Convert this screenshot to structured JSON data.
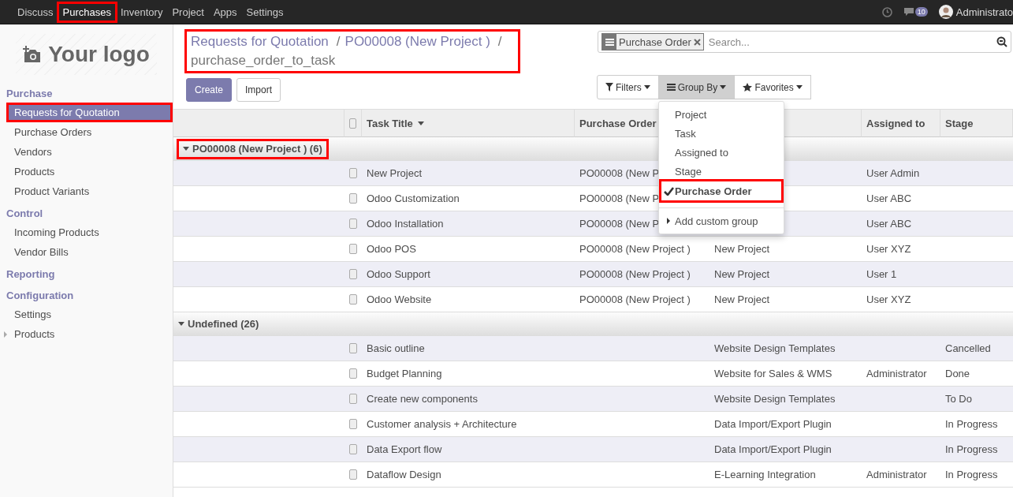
{
  "top_menu": [
    {
      "label": "Discuss",
      "selected": false,
      "highlighted": false
    },
    {
      "label": "Purchases",
      "selected": true,
      "highlighted": true
    },
    {
      "label": "Inventory",
      "selected": false,
      "highlighted": false
    },
    {
      "label": "Project",
      "selected": false,
      "highlighted": false
    },
    {
      "label": "Apps",
      "selected": false,
      "highlighted": false
    },
    {
      "label": "Settings",
      "selected": false,
      "highlighted": false
    }
  ],
  "systray": {
    "message_count": "10",
    "user": "Administrato"
  },
  "logo": {
    "text": "Your logo"
  },
  "sidebar": [
    {
      "heading": "Purchase",
      "items": [
        {
          "label": "Requests for Quotation",
          "selected": true,
          "highlighted": true,
          "expandable": false
        },
        {
          "label": "Purchase Orders",
          "selected": false,
          "highlighted": false,
          "expandable": false
        },
        {
          "label": "Vendors",
          "selected": false,
          "highlighted": false,
          "expandable": false
        },
        {
          "label": "Products",
          "selected": false,
          "highlighted": false,
          "expandable": false
        },
        {
          "label": "Product Variants",
          "selected": false,
          "highlighted": false,
          "expandable": false
        }
      ]
    },
    {
      "heading": "Control",
      "items": [
        {
          "label": "Incoming Products",
          "selected": false,
          "highlighted": false,
          "expandable": false
        },
        {
          "label": "Vendor Bills",
          "selected": false,
          "highlighted": false,
          "expandable": false
        }
      ]
    },
    {
      "heading": "Reporting"
    },
    {
      "heading": "Configuration",
      "items": [
        {
          "label": "Settings",
          "selected": false,
          "highlighted": false,
          "expandable": false
        },
        {
          "label": "Products",
          "selected": false,
          "highlighted": false,
          "expandable": true
        }
      ]
    }
  ],
  "breadcrumb": {
    "highlighted": true,
    "separator": "/",
    "items": [
      "Requests for Quotation",
      "PO00008 (New Project )",
      "purchase_order_to_task"
    ]
  },
  "buttons": [
    "Create",
    "Import"
  ],
  "search": {
    "facet": "Purchase Order",
    "placeholder": "Search..."
  },
  "search_options": [
    {
      "label": "Filters",
      "selected": false,
      "kind": "filter"
    },
    {
      "label": "Group By",
      "selected": true,
      "kind": "group"
    },
    {
      "label": "Favorites",
      "selected": false,
      "kind": "star"
    }
  ],
  "group_by_menu": [
    {
      "label": "Project",
      "checked": false,
      "highlighted": false,
      "kind": "option"
    },
    {
      "label": "Task",
      "checked": false,
      "highlighted": false,
      "kind": "option"
    },
    {
      "label": "Assigned to",
      "checked": false,
      "highlighted": false,
      "kind": "option"
    },
    {
      "label": "Stage",
      "checked": false,
      "highlighted": false,
      "kind": "option"
    },
    {
      "label": "Purchase Order",
      "checked": true,
      "highlighted": true,
      "kind": "option"
    },
    {
      "label": "Add custom group",
      "checked": false,
      "highlighted": false,
      "kind": "submenu"
    }
  ],
  "table": {
    "all_checked": false,
    "columns": [
      "Task Title",
      "Purchase Order",
      "",
      "Assigned to",
      "Stage"
    ],
    "groups": [
      {
        "title": "PO00008 (New Project ) (6)",
        "expanded": true,
        "highlighted": true,
        "rows": [
          {
            "checked": false,
            "cells": [
              "New Project",
              "PO00008 (New P",
              "",
              "User Admin",
              ""
            ]
          },
          {
            "checked": false,
            "cells": [
              "Odoo Customization",
              "PO00008 (New P",
              "",
              "User ABC",
              ""
            ]
          },
          {
            "checked": false,
            "cells": [
              "Odoo Installation",
              "PO00008 (New P",
              "",
              "User ABC",
              ""
            ]
          },
          {
            "checked": false,
            "cells": [
              "Odoo POS",
              "PO00008 (New Project )",
              "New Project",
              "User XYZ",
              ""
            ]
          },
          {
            "checked": false,
            "cells": [
              "Odoo Support",
              "PO00008 (New Project )",
              "New Project",
              "User 1",
              ""
            ]
          },
          {
            "checked": false,
            "cells": [
              "Odoo Website",
              "PO00008 (New Project )",
              "New Project",
              "User XYZ",
              ""
            ]
          }
        ]
      },
      {
        "title": "Undefined (26)",
        "expanded": true,
        "highlighted": false,
        "rows": [
          {
            "checked": false,
            "cells": [
              "Basic outline",
              "",
              "Website Design Templates",
              "",
              "Cancelled"
            ]
          },
          {
            "checked": false,
            "cells": [
              "Budget Planning",
              "",
              "Website for Sales & WMS",
              "Administrator",
              "Done"
            ]
          },
          {
            "checked": false,
            "cells": [
              "Create new components",
              "",
              "Website Design Templates",
              "",
              "To Do"
            ]
          },
          {
            "checked": false,
            "cells": [
              "Customer analysis + Architecture",
              "",
              "Data Import/Export Plugin",
              "",
              "In Progress"
            ]
          },
          {
            "checked": false,
            "cells": [
              "Data Export flow",
              "",
              "Data Import/Export Plugin",
              "",
              "In Progress"
            ]
          },
          {
            "checked": false,
            "cells": [
              "Dataflow Design",
              "",
              "E-Learning Integration",
              "Administrator",
              "In Progress"
            ]
          }
        ]
      }
    ]
  }
}
